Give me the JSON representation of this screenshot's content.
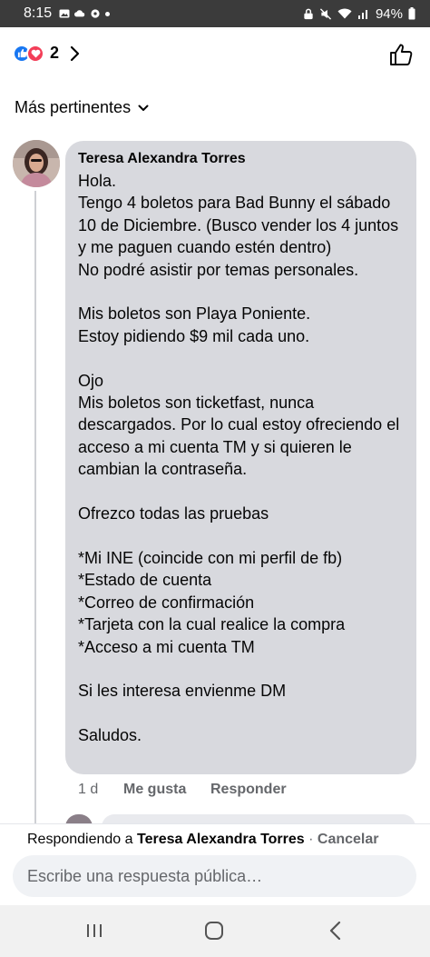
{
  "status_bar": {
    "time": "8:15",
    "battery": "94%"
  },
  "header": {
    "reaction_count": "2",
    "reactions": [
      "like-icon",
      "love-icon"
    ]
  },
  "sort": {
    "label": "Más pertinentes"
  },
  "comment": {
    "author": "Teresa Alexandra Torres",
    "text": "Hola.\nTengo 4 boletos para Bad Bunny el sábado 10 de Diciembre. (Busco vender los 4 juntos y me paguen cuando estén dentro)\nNo podré asistir por temas personales.\n\nMis boletos son Playa Poniente.\nEstoy pidiendo $9 mil cada uno.\n\nOjo\nMis boletos son ticketfast, nunca descargados. Por lo cual estoy ofreciendo el acceso a mi cuenta TM y si quieren le cambian la contraseña.\n\nOfrezco todas las pruebas\n\n*Mi INE (coincide con mi perfil de fb)\n*Estado de cuenta\n*Correo de confirmación\n*Tarjeta con la cual realice la compra\n*Acceso a mi cuenta TM\n\nSi les interesa envienme DM\n\nSaludos.",
    "time": "1 d",
    "like_label": "Me gusta",
    "reply_label": "Responder"
  },
  "composer": {
    "replying_prefix": "Respondiendo a",
    "replying_name": "Teresa Alexandra Torres",
    "separator": " · ",
    "cancel_label": "Cancelar",
    "placeholder": "Escribe una respuesta pública…"
  },
  "colors": {
    "like": "#1877f2",
    "love": "#f33e58",
    "bubble": "#d8d9de",
    "secondary_text": "#65676b"
  }
}
